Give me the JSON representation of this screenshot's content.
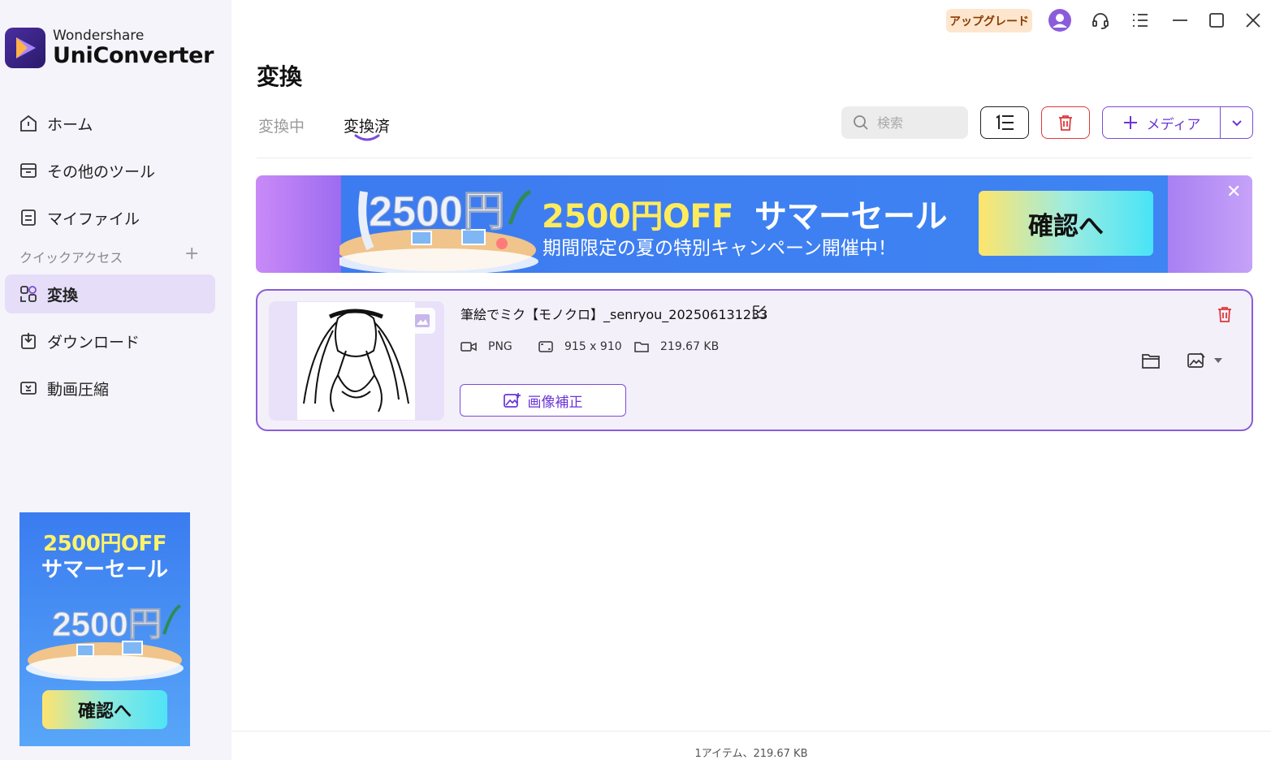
{
  "app": {
    "company": "Wondershare",
    "product": "UniConverter",
    "brand_color": "#6a35d6",
    "upgrade_label": "アップグレード"
  },
  "sidebar": {
    "items": [
      {
        "label": "ホーム",
        "icon": "home-icon"
      },
      {
        "label": "その他のツール",
        "icon": "toolbox-icon"
      },
      {
        "label": "マイファイル",
        "icon": "file-icon"
      },
      {
        "label": "変換",
        "icon": "convert-icon",
        "active": true
      },
      {
        "label": "ダウンロード",
        "icon": "download-icon"
      },
      {
        "label": "動画圧縮",
        "icon": "compress-icon"
      }
    ],
    "quick_access_label": "クイックアクセス",
    "quick_access_add": "+",
    "ad": {
      "line1": "2500円OFF",
      "line2": "サマーセール",
      "art_text": "2500円",
      "button": "確認へ"
    }
  },
  "main": {
    "title": "変換",
    "tabs": [
      {
        "label": "変換中",
        "active": false
      },
      {
        "label": "変換済",
        "active": true
      }
    ],
    "search": {
      "placeholder": "検索"
    },
    "add_media_label": "メディア",
    "banner": {
      "art_text": "2500円",
      "headline_yellow": "2500円OFF",
      "headline_white": "サマーセール",
      "subtitle": "期間限定の夏の特別キャンペーン開催中！",
      "button": "確認へ",
      "close": "✕"
    },
    "files": [
      {
        "name": "筆絵でミク【モノクロ】_senryou_202506131233",
        "format": "PNG",
        "resolution": "915 x 910",
        "size": "219.67 KB",
        "action_label": "画像補正"
      }
    ]
  },
  "status_bar": {
    "summary": "1アイテム、219.67 KB"
  }
}
